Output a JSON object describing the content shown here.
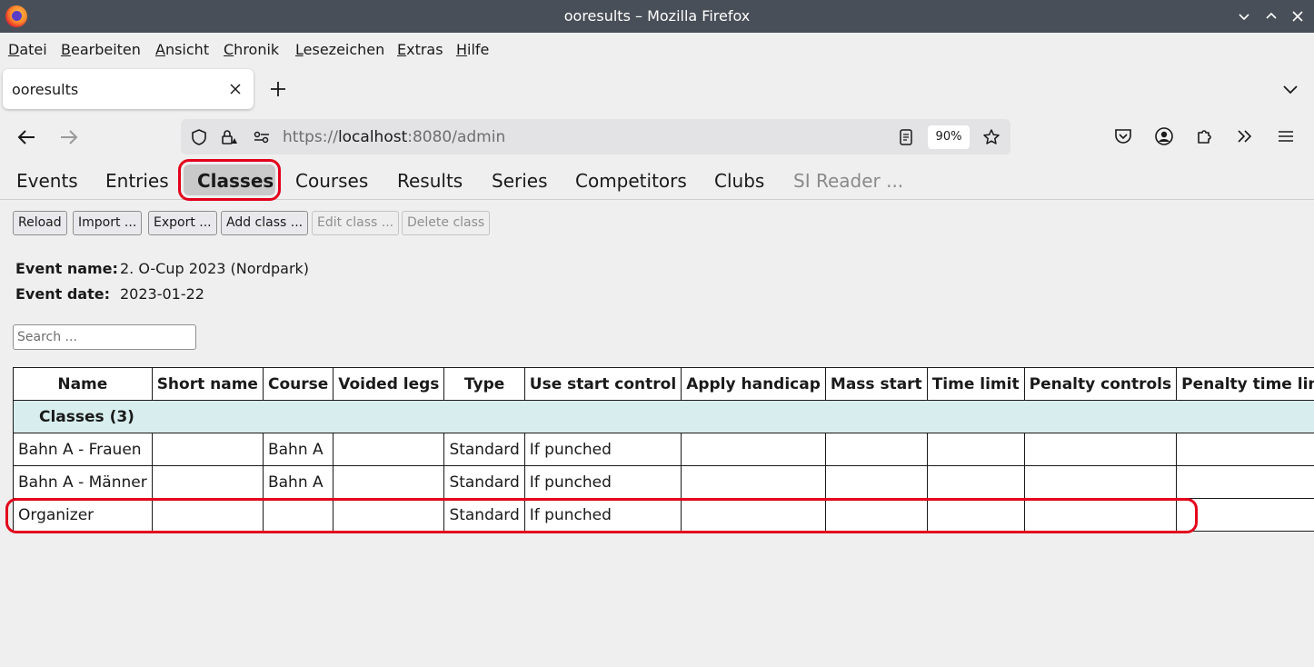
{
  "window": {
    "title": "ooresults – Mozilla Firefox"
  },
  "menu": [
    "Datei",
    "Bearbeiten",
    "Ansicht",
    "Chronik",
    "Lesezeichen",
    "Extras",
    "Hilfe"
  ],
  "tab": {
    "label": "ooresults"
  },
  "urlbar": {
    "scheme": "https://",
    "host": "localhost",
    "path": ":8080/admin",
    "zoom": "90%"
  },
  "appnav": {
    "items": [
      "Events",
      "Entries",
      "Classes",
      "Courses",
      "Results",
      "Series",
      "Competitors",
      "Clubs",
      "SI Reader ..."
    ],
    "active": "Classes"
  },
  "toolbar": {
    "reload": "Reload",
    "import": "Import ...",
    "export": "Export ...",
    "add": "Add class ...",
    "edit": "Edit class ...",
    "delete": "Delete class"
  },
  "event": {
    "name_label": "Event name:",
    "name": "2. O-Cup 2023 (Nordpark)",
    "date_label": "Event date:",
    "date": "2023-01-22"
  },
  "search": {
    "placeholder": "Search ..."
  },
  "table": {
    "headers": [
      "Name",
      "Short name",
      "Course",
      "Voided legs",
      "Type",
      "Use start control",
      "Apply handicap",
      "Mass start",
      "Time limit",
      "Penalty controls",
      "Penalty time limit"
    ],
    "group": "Classes  (3)",
    "rows": [
      [
        "Bahn A - Frauen",
        "",
        "Bahn A",
        "",
        "Standard",
        "If punched",
        "",
        "",
        "",
        "",
        ""
      ],
      [
        "Bahn A - Männer",
        "",
        "Bahn A",
        "",
        "Standard",
        "If punched",
        "",
        "",
        "",
        "",
        ""
      ],
      [
        "Organizer",
        "",
        "",
        "",
        "Standard",
        "If punched",
        "",
        "",
        "",
        "",
        ""
      ]
    ]
  }
}
